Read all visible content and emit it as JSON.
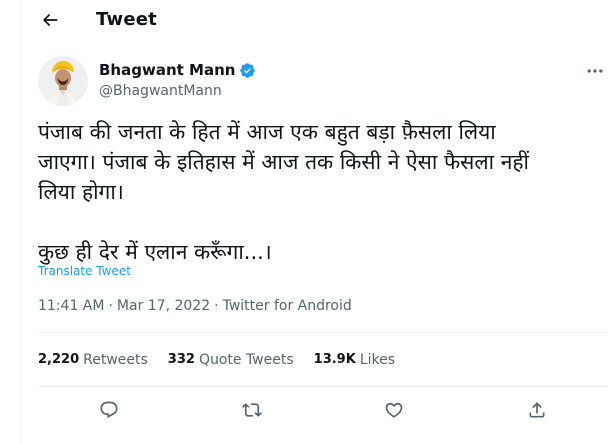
{
  "header": {
    "title": "Tweet"
  },
  "author": {
    "name": "Bhagwant Mann",
    "handle": "@BhagwantMann",
    "verified": true
  },
  "tweet": {
    "text": "पंजाब की जनता के हित में आज एक बहुत बड़ा फ़ैसला लिया\nजाएगा। पंजाब के इतिहास में आज तक किसी ने ऐसा फैसला नहीं\nलिया होगा।\n\nकुछ ही देर में एलान करूँगा...।",
    "translate_label": "Translate Tweet",
    "time": "11:41 AM",
    "separator": "·",
    "date": "Mar 17, 2022",
    "source": "Twitter for Android"
  },
  "stats": {
    "retweets": {
      "count": "2,220",
      "label": "Retweets"
    },
    "quote_tweets": {
      "count": "332",
      "label": "Quote Tweets"
    },
    "likes": {
      "count": "13.9K",
      "label": "Likes"
    }
  },
  "colors": {
    "accent": "#1d9bf0",
    "muted": "#536471",
    "text": "#0f1419",
    "border": "#eff3f4"
  },
  "icons": [
    "back-arrow-icon",
    "verified-badge-icon",
    "more-icon",
    "reply-icon",
    "retweet-icon",
    "like-icon",
    "share-icon"
  ]
}
